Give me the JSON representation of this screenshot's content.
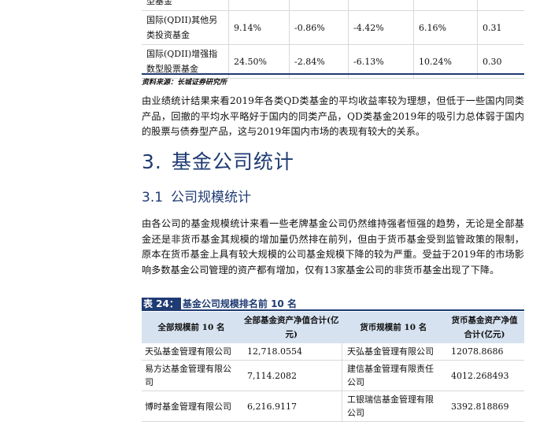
{
  "top_table": {
    "rows": [
      {
        "name": "型基金",
        "v1": "",
        "v2": "",
        "v3": "",
        "v4": "",
        "v5": ""
      },
      {
        "name": "国际(QDII)其他另类投资基金",
        "v1": "9.14%",
        "v2": "-0.86%",
        "v3": "-4.42%",
        "v4": "6.16%",
        "v5": "0.31"
      },
      {
        "name": "国际(QDII)增强指数型股票基金",
        "v1": "24.50%",
        "v2": "-2.84%",
        "v3": "-6.13%",
        "v4": "10.24%",
        "v5": "0.30"
      }
    ]
  },
  "source": "资料来源：长城证券研究所",
  "paragraph1": "由业绩统计结果来看2019年各类QD类基金的平均收益率较为理想，但低于一些国内同类产品，回撤的平均水平略好于国内的同类产品，QD类基金2019年的吸引力总体弱于国内的股票与债券型产品，这与2019年国内市场的表现有较大的关系。",
  "section": {
    "number": "3.",
    "title": "基金公司统计"
  },
  "subsection": {
    "number": "3.1",
    "title": "公司规模统计"
  },
  "paragraph2": "由各公司的基金规模统计来看一些老牌基金公司仍然维持强者恒强的趋势，无论是全部基金还是非货币基金其规模的增加量仍然排在前列，但由于货币基金受到监管政策的限制，原本在货币基金上具有较大规模的公司基金规模下降的较为严重。受益于2019年的市场影响多数基金公司管理的资产都有增加，仅有13家基金公司的非货币基金出现了下降。",
  "table_caption": {
    "tag": "表 24：",
    "title": "基金公司规模排名前 10 名"
  },
  "bottom_table": {
    "headers": [
      "全部规模前 10 名",
      "全部基金资产净值合计(亿元)",
      "货币规模前 10 名",
      "货币基金资产净值合计(亿元)"
    ],
    "rows": [
      {
        "c1": "天弘基金管理有限公司",
        "c2": "12,718.0554",
        "c3": "天弘基金管理有限公司",
        "c4": "12078.8686"
      },
      {
        "c1": "易方达基金管理有限公司",
        "c2": "7,114.2082",
        "c3": "建信基金管理有限责任公司",
        "c4": "4012.268493"
      },
      {
        "c1": "博时基金管理有限公司",
        "c2": "6,216.9117",
        "c3": "工银瑞信基金管理有限公司",
        "c4": "3392.818869"
      }
    ]
  },
  "colors": {
    "accent": "#1f3b73",
    "header_fill": "#d6e2f0"
  }
}
